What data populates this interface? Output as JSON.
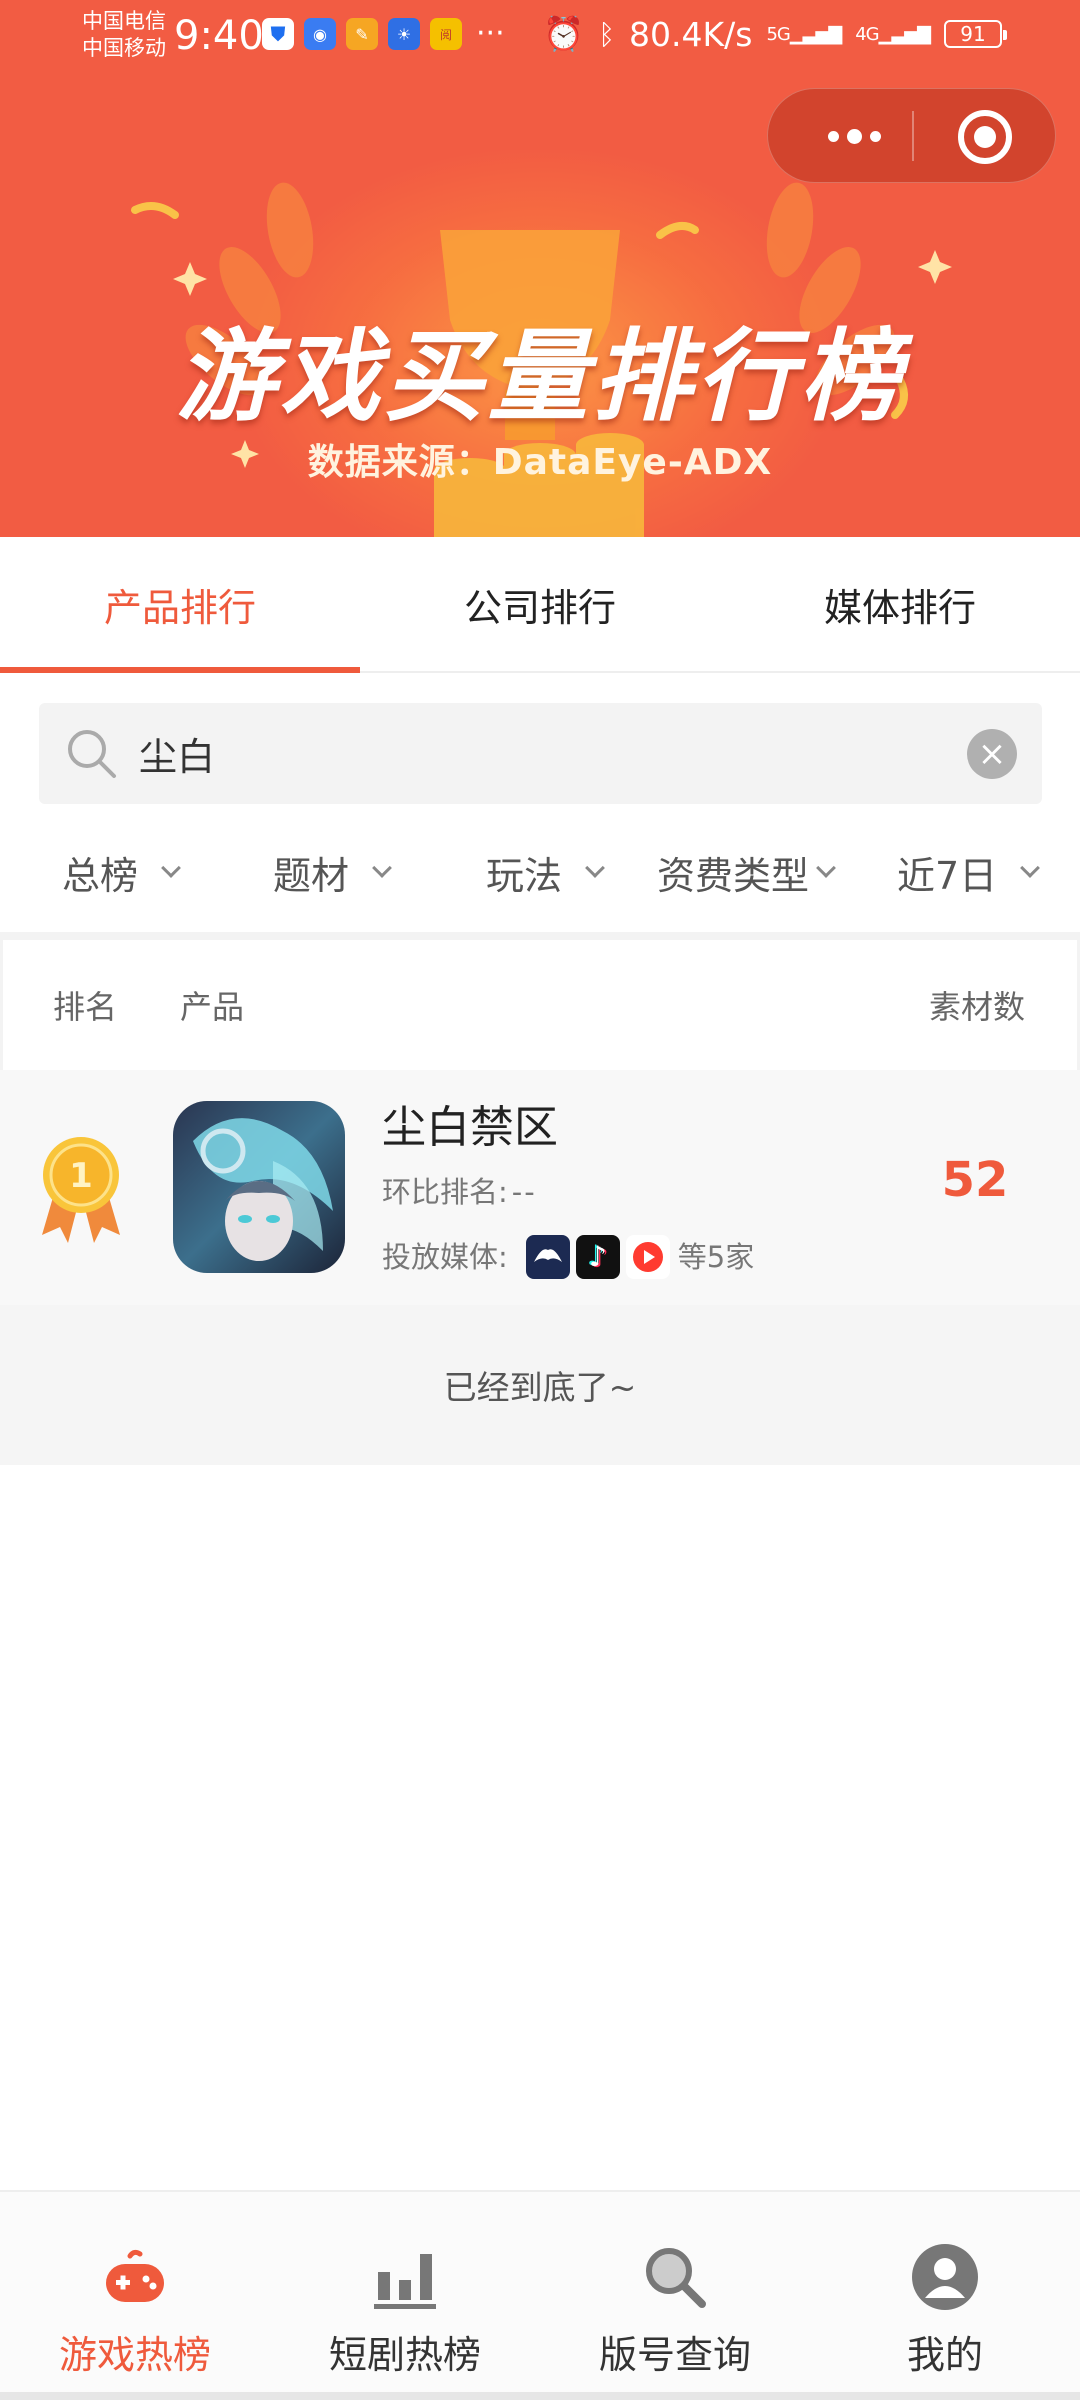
{
  "status_bar": {
    "carrier_1": "中国电信",
    "carrier_2": "中国移动",
    "time": "9:40",
    "app_icons": [
      "shield-app",
      "browser-app",
      "orange-app",
      "bulb-app",
      "reader-app"
    ],
    "more": "···",
    "net_speed": "80.4K/s",
    "signal_1": "5G",
    "signal_2": "4G",
    "battery": "91"
  },
  "capsule": {
    "more_label": "more",
    "close_label": "close"
  },
  "banner": {
    "title": "游戏买量排行榜",
    "subtitle": "数据来源：DataEye-ADX"
  },
  "tabs": [
    {
      "label": "产品排行",
      "active": true
    },
    {
      "label": "公司排行",
      "active": false
    },
    {
      "label": "媒体排行",
      "active": false
    }
  ],
  "search": {
    "value": "尘白",
    "placeholder": ""
  },
  "filters": [
    {
      "label": "总榜"
    },
    {
      "label": "题材"
    },
    {
      "label": "玩法"
    },
    {
      "label": "资费类型"
    },
    {
      "label": "近7日"
    }
  ],
  "list_header": {
    "rank": "排名",
    "product": "产品",
    "count": "素材数"
  },
  "rows": [
    {
      "rank": "1",
      "name": "尘白禁区",
      "rank_change_label": "环比排名:",
      "rank_change_value": "--",
      "media_label": "投放媒体:",
      "media_icons": [
        "eagle-media-icon",
        "douyin-media-icon",
        "kuaishou-media-icon"
      ],
      "media_more": "等5家",
      "count": "52"
    }
  ],
  "end_notice": "已经到底了~",
  "bottom_nav": [
    {
      "label": "游戏热榜",
      "icon": "gamepad-icon",
      "active": true
    },
    {
      "label": "短剧热榜",
      "icon": "bar-chart-icon",
      "active": false
    },
    {
      "label": "版号查询",
      "icon": "search-icon",
      "active": false
    },
    {
      "label": "我的",
      "icon": "user-icon",
      "active": false
    }
  ],
  "colors": {
    "brand": "#f25c43",
    "accent": "#ef5a3c",
    "gold": "#f7b52b"
  }
}
